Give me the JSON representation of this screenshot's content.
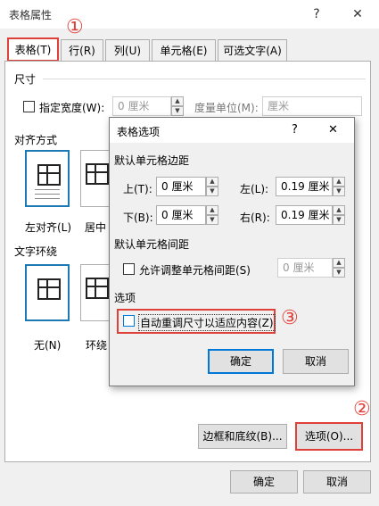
{
  "window": {
    "title": "表格属性",
    "help": "?",
    "close": "✕"
  },
  "tabs": [
    "表格(T)",
    "行(R)",
    "列(U)",
    "单元格(E)",
    "可选文字(A)"
  ],
  "size": {
    "section": "尺寸",
    "preferred_width_label": "指定宽度(W):",
    "width_value": "0 厘米",
    "measure_label": "度量单位(M):",
    "measure_value": "厘米"
  },
  "alignment": {
    "section": "对齐方式",
    "options": [
      "左对齐(L)",
      "居中"
    ]
  },
  "wrapping": {
    "section": "文字环绕",
    "options": [
      "无(N)",
      "环绕"
    ]
  },
  "buttons": {
    "borders": "边框和底纹(B)...",
    "options": "选项(O)...",
    "ok": "确定",
    "cancel": "取消"
  },
  "options_dialog": {
    "title": "表格选项",
    "help": "?",
    "close": "✕",
    "margins_section": "默认单元格边距",
    "top_label": "上(T):",
    "top_value": "0 厘米",
    "left_label": "左(L):",
    "left_value": "0.19 厘米",
    "bottom_label": "下(B):",
    "bottom_value": "0 厘米",
    "right_label": "右(R):",
    "right_value": "0.19 厘米",
    "spacing_section": "默认单元格间距",
    "allow_spacing_label": "允许调整单元格间距(S)",
    "spacing_value": "0 厘米",
    "options_section": "选项",
    "autofit_label": "自动重调尺寸以适应内容(Z)",
    "ok": "确定",
    "cancel": "取消"
  },
  "callouts": [
    "①",
    "②",
    "③"
  ],
  "colors": {
    "callout": "#e0403a",
    "focus": "#0078d7"
  }
}
